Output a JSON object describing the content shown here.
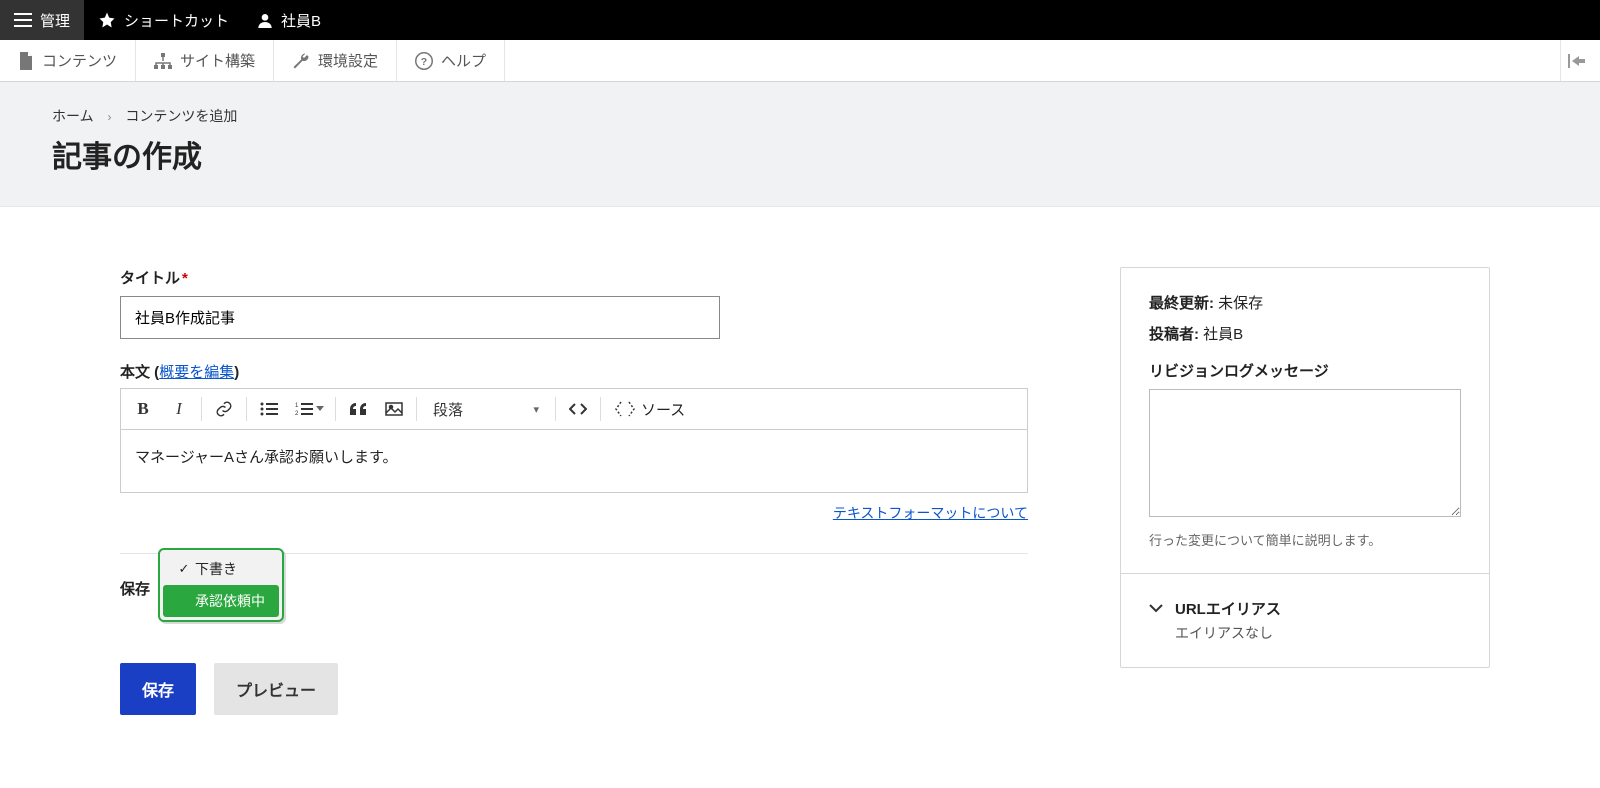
{
  "toolbar_top": {
    "manage": "管理",
    "shortcuts": "ショートカット",
    "user": "社員B"
  },
  "toolbar_second": {
    "content": "コンテンツ",
    "structure": "サイト構築",
    "config": "環境設定",
    "help": "ヘルプ"
  },
  "breadcrumb": {
    "home": "ホーム",
    "add_content": "コンテンツを追加"
  },
  "page_title": "記事の作成",
  "form": {
    "title_label": "タイトル",
    "title_value": "社員B作成記事",
    "body_label": "本文",
    "body_summary_link": "概要を編集",
    "body_content": "マネージャーAさん承認お願いします。",
    "format_about": "テキストフォーマットについて"
  },
  "ckeditor": {
    "heading": "段落",
    "source": "ソース"
  },
  "state": {
    "label": "保存",
    "option_draft": "下書き",
    "option_review": "承認依頼中"
  },
  "actions": {
    "save": "保存",
    "preview": "プレビュー"
  },
  "sidebar": {
    "last_updated_label": "最終更新:",
    "last_updated_value": "未保存",
    "author_label": "投稿者:",
    "author_value": "社員B",
    "revlog_label": "リビジョンログメッセージ",
    "revlog_desc": "行った変更について簡単に説明します。",
    "url_alias_title": "URLエイリアス",
    "url_alias_sub": "エイリアスなし"
  }
}
